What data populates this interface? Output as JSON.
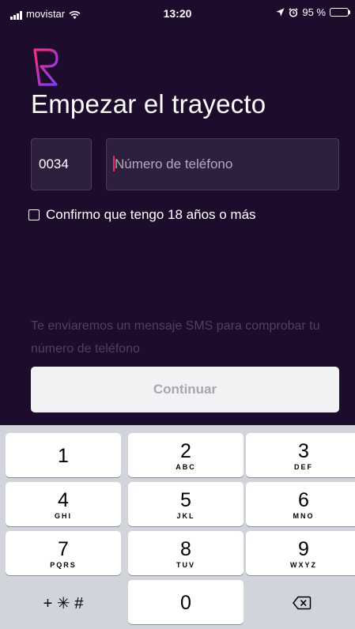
{
  "status_bar": {
    "carrier": "movistar",
    "time": "13:20",
    "battery": "95 %",
    "battery_level": 0.95,
    "battery_color": "#4cd964"
  },
  "screen": {
    "title": "Empezar el trayecto",
    "country_code": "0034",
    "phone_placeholder": "Número de teléfono",
    "age_confirmation": "Confirmo que tengo 18 años o más",
    "sms_info": "Te enviaremos un mensaje SMS para comprobar tu número de teléfono",
    "continue_label": "Continuar"
  },
  "colors": {
    "background": "#1d0c2c",
    "field_background": "#2e1f3e",
    "cursor": "#e2306c",
    "logo_gradient": [
      "#ff2d7a",
      "#7a3cff"
    ]
  },
  "icons": {
    "signal": "signal-bars-icon",
    "wifi": "wifi-icon",
    "location": "location-arrow-icon",
    "alarm": "alarm-clock-icon",
    "battery": "battery-icon",
    "logo": "r-logo-icon",
    "delete": "delete-backspace-icon"
  },
  "keyboard": {
    "keys": [
      {
        "digit": "1",
        "letters": ""
      },
      {
        "digit": "2",
        "letters": "ABC"
      },
      {
        "digit": "3",
        "letters": "DEF"
      },
      {
        "digit": "4",
        "letters": "GHI"
      },
      {
        "digit": "5",
        "letters": "JKL"
      },
      {
        "digit": "6",
        "letters": "MNO"
      },
      {
        "digit": "7",
        "letters": "PQRS"
      },
      {
        "digit": "8",
        "letters": "TUV"
      },
      {
        "digit": "9",
        "letters": "WXYZ"
      },
      {
        "digit": "0",
        "letters": ""
      }
    ],
    "symbols_label": "+ ✳ #"
  }
}
